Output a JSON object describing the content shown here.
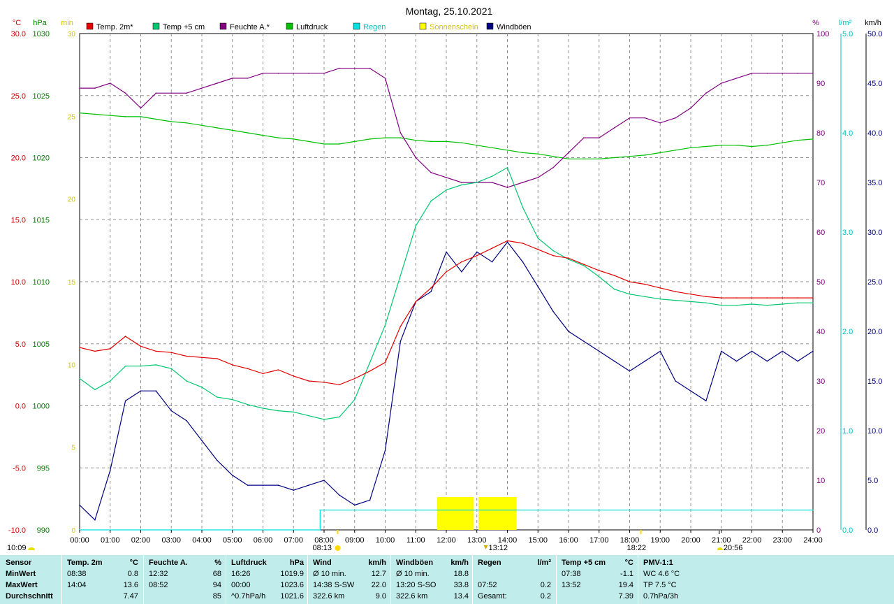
{
  "title": "Montag, 25.10.2021",
  "axes": {
    "temp": {
      "unit": "°C",
      "ticks": [
        "30.0",
        "25.0",
        "20.0",
        "15.0",
        "10.0",
        "5.0",
        "0.0",
        "-5.0",
        "-10.0"
      ],
      "color": "#cc0000"
    },
    "pressure": {
      "unit": "hPa",
      "ticks": [
        "1030",
        "1025",
        "1020",
        "1015",
        "1010",
        "1005",
        "1000",
        "995",
        "990"
      ],
      "color": "#008000"
    },
    "minutes": {
      "unit": "min",
      "ticks": [
        "30",
        "25",
        "20",
        "15",
        "10",
        "5",
        "0"
      ],
      "color": "#d4c400"
    },
    "humidity": {
      "unit": "%",
      "ticks": [
        "100",
        "90",
        "80",
        "70",
        "60",
        "50",
        "40",
        "30",
        "20",
        "10",
        "0"
      ],
      "color": "#800080"
    },
    "rain": {
      "unit": "l/m²",
      "ticks": [
        "5.0",
        "4.0",
        "3.0",
        "2.0",
        "1.0",
        "0.0"
      ],
      "color": "#00c0c0"
    },
    "wind": {
      "unit": "km/h",
      "ticks": [
        "50.0",
        "45.0",
        "40.0",
        "35.0",
        "30.0",
        "25.0",
        "20.0",
        "15.0",
        "10.0",
        "5.0",
        "0.0"
      ],
      "color": "#000080"
    }
  },
  "legend": [
    {
      "label": "Temp. 2m*",
      "color": "#e00000"
    },
    {
      "label": "Temp +5 cm",
      "color": "#00c870"
    },
    {
      "label": "Feuchte A.*",
      "color": "#800080"
    },
    {
      "label": "Luftdruck",
      "color": "#00c000"
    },
    {
      "label": "Regen",
      "color": "#00e0e0"
    },
    {
      "label": "Sonnenschein",
      "color": "#ffff00"
    },
    {
      "label": "Windböen",
      "color": "#000080"
    }
  ],
  "time_ticks": [
    "00:00",
    "01:00",
    "02:00",
    "03:00",
    "04:00",
    "05:00",
    "06:00",
    "07:00",
    "08:00",
    "09:00",
    "10:00",
    "11:00",
    "12:00",
    "13:00",
    "14:00",
    "15:00",
    "16:00",
    "17:00",
    "18:00",
    "19:00",
    "20:00",
    "21:00",
    "22:00",
    "23:00",
    "24:00"
  ],
  "markers": {
    "moonset": "10:09",
    "sunrise": "08:13",
    "noon": "13:12",
    "sunset": "18:22",
    "moonrise": "20:56"
  },
  "chart_data": {
    "type": "line",
    "x_unit": "hour of day",
    "xlim": [
      0,
      24
    ],
    "series": [
      {
        "name": "Temp. 2m*",
        "axis": "temp",
        "x": [
          0,
          0.5,
          1,
          1.5,
          2,
          2.5,
          3,
          3.5,
          4,
          4.5,
          5,
          5.5,
          6,
          6.5,
          7,
          7.5,
          8,
          8.5,
          9,
          9.5,
          10,
          10.5,
          11,
          11.5,
          12,
          12.5,
          13,
          13.5,
          14,
          14.5,
          15,
          15.5,
          16,
          16.5,
          17,
          17.5,
          18,
          18.5,
          19,
          19.5,
          20,
          20.5,
          21,
          21.5,
          22,
          22.5,
          23,
          23.5,
          24
        ],
        "y": [
          4.7,
          4.4,
          4.6,
          5.6,
          4.8,
          4.4,
          4.3,
          4.0,
          3.9,
          3.8,
          3.3,
          3.0,
          2.6,
          2.9,
          2.4,
          2.0,
          1.9,
          1.7,
          2.2,
          2.8,
          3.5,
          6.4,
          8.4,
          9.5,
          10.8,
          11.6,
          12.1,
          12.7,
          13.3,
          13.1,
          12.6,
          12.1,
          11.9,
          11.4,
          10.9,
          10.5,
          10.0,
          9.8,
          9.5,
          9.2,
          9.0,
          8.8,
          8.7,
          8.7,
          8.7,
          8.7,
          8.7,
          8.7,
          8.7
        ]
      },
      {
        "name": "Temp +5 cm",
        "axis": "temp",
        "x": [
          0,
          0.5,
          1,
          1.5,
          2,
          2.5,
          3,
          3.5,
          4,
          4.5,
          5,
          5.5,
          6,
          6.5,
          7,
          7.5,
          8,
          8.5,
          9,
          9.5,
          10,
          10.5,
          11,
          11.5,
          12,
          12.5,
          13,
          13.5,
          14,
          14.5,
          15,
          15.5,
          16,
          16.5,
          17,
          17.5,
          18,
          18.5,
          19,
          19.5,
          20,
          20.5,
          21,
          21.5,
          22,
          22.5,
          23,
          23.5,
          24
        ],
        "y": [
          2.2,
          1.3,
          2.0,
          3.2,
          3.2,
          3.3,
          3.0,
          2.0,
          1.5,
          0.7,
          0.5,
          0.1,
          -0.2,
          -0.4,
          -0.5,
          -0.8,
          -1.1,
          -0.9,
          0.5,
          3.5,
          6.5,
          10.5,
          14.5,
          16.5,
          17.4,
          17.8,
          18.0,
          18.5,
          19.2,
          16.0,
          13.5,
          12.5,
          11.8,
          11.3,
          10.4,
          9.4,
          9.0,
          8.8,
          8.6,
          8.5,
          8.4,
          8.3,
          8.1,
          8.1,
          8.2,
          8.1,
          8.2,
          8.3,
          8.3
        ]
      },
      {
        "name": "Feuchte A.*",
        "axis": "humidity",
        "x": [
          0,
          0.5,
          1,
          1.5,
          2,
          2.5,
          3,
          3.5,
          4,
          4.5,
          5,
          5.5,
          6,
          6.5,
          7,
          7.5,
          8,
          8.5,
          9,
          9.5,
          10,
          10.5,
          11,
          11.5,
          12,
          12.5,
          13,
          13.5,
          14,
          14.5,
          15,
          15.5,
          16,
          16.5,
          17,
          17.5,
          18,
          18.5,
          19,
          19.5,
          20,
          20.5,
          21,
          21.5,
          22,
          22.5,
          23,
          23.5,
          24
        ],
        "y": [
          89,
          89,
          90,
          88,
          85,
          88,
          88,
          88,
          89,
          90,
          91,
          91,
          92,
          92,
          92,
          92,
          92,
          93,
          93,
          93,
          91,
          80,
          75,
          72,
          71,
          70,
          70,
          70,
          69,
          70,
          71,
          73,
          76,
          79,
          79,
          81,
          83,
          83,
          82,
          83,
          85,
          88,
          90,
          91,
          92,
          92,
          92,
          92,
          92
        ]
      },
      {
        "name": "Luftdruck",
        "axis": "pressure",
        "x": [
          0,
          0.5,
          1,
          1.5,
          2,
          2.5,
          3,
          3.5,
          4,
          4.5,
          5,
          5.5,
          6,
          6.5,
          7,
          7.5,
          8,
          8.5,
          9,
          9.5,
          10,
          10.5,
          11,
          11.5,
          12,
          12.5,
          13,
          13.5,
          14,
          14.5,
          15,
          15.5,
          16,
          16.5,
          17,
          17.5,
          18,
          18.5,
          19,
          19.5,
          20,
          20.5,
          21,
          21.5,
          22,
          22.5,
          23,
          23.5,
          24
        ],
        "y": [
          1023.6,
          1023.5,
          1023.4,
          1023.3,
          1023.3,
          1023.1,
          1022.9,
          1022.8,
          1022.6,
          1022.4,
          1022.2,
          1022.0,
          1021.8,
          1021.6,
          1021.5,
          1021.3,
          1021.1,
          1021.1,
          1021.3,
          1021.5,
          1021.6,
          1021.6,
          1021.4,
          1021.3,
          1021.3,
          1021.2,
          1021.0,
          1020.8,
          1020.6,
          1020.4,
          1020.3,
          1020.1,
          1019.9,
          1019.9,
          1019.9,
          1020.0,
          1020.1,
          1020.2,
          1020.4,
          1020.6,
          1020.8,
          1020.9,
          1021.0,
          1021.0,
          1020.9,
          1021.0,
          1021.2,
          1021.4,
          1021.5
        ]
      },
      {
        "name": "Windböen",
        "axis": "wind",
        "x": [
          0,
          0.5,
          1,
          1.5,
          2,
          2.5,
          3,
          3.5,
          4,
          4.5,
          5,
          5.5,
          6,
          6.5,
          7,
          7.5,
          8,
          8.5,
          9,
          9.5,
          10,
          10.5,
          11,
          11.5,
          12,
          12.5,
          13,
          13.5,
          14,
          14.5,
          15,
          15.5,
          16,
          16.5,
          17,
          17.5,
          18,
          18.5,
          19,
          19.5,
          20,
          20.5,
          21,
          21.5,
          22,
          22.5,
          23,
          23.5,
          24
        ],
        "y": [
          2.5,
          1.0,
          6.0,
          13.0,
          14.0,
          14.0,
          12.0,
          11.0,
          9.0,
          7.0,
          5.5,
          4.5,
          4.5,
          4.5,
          4.0,
          4.5,
          5.0,
          3.5,
          2.5,
          3.0,
          8.0,
          19.0,
          23.0,
          24.0,
          28.0,
          26.0,
          28.0,
          27.0,
          29.0,
          27.0,
          24.5,
          22.0,
          20.0,
          19.0,
          18.0,
          17.0,
          16.0,
          17.0,
          18.0,
          15.0,
          14.0,
          13.0,
          18.0,
          17.0,
          18.0,
          17.0,
          18.0,
          17.0,
          18.0
        ]
      },
      {
        "name": "Regen",
        "axis": "rain",
        "x": [
          0,
          7.87,
          7.87,
          24
        ],
        "y": [
          0,
          0,
          0.2,
          0.2
        ]
      }
    ],
    "sunshine_periods": [
      [
        11.7,
        12.9
      ],
      [
        13.05,
        14.3
      ]
    ]
  },
  "stats": {
    "sensor_header": "Sensor",
    "row_labels": [
      "MinWert",
      "MaxWert",
      "Durchschnitt"
    ],
    "columns": [
      {
        "name": "Temp. 2m",
        "unit": "°C",
        "rows": [
          [
            "08:38",
            "0.8"
          ],
          [
            "14:04",
            "13.6"
          ],
          [
            "",
            "7.47"
          ]
        ]
      },
      {
        "name": "Feuchte A.",
        "unit": "%",
        "rows": [
          [
            "12:32",
            "68"
          ],
          [
            "08:52",
            "94"
          ],
          [
            "",
            "85"
          ]
        ]
      },
      {
        "name": "Luftdruck",
        "unit": "hPa",
        "rows": [
          [
            "16:26",
            "1019.9"
          ],
          [
            "00:00",
            "1023.6"
          ],
          [
            "^0.7hPa/h",
            "1021.6"
          ]
        ]
      },
      {
        "name": "Wind",
        "unit": "km/h",
        "rows": [
          [
            "Ø 10 min.",
            "12.7"
          ],
          [
            "14:38 S-SW",
            "22.0"
          ],
          [
            "322.6 km",
            "9.0"
          ]
        ]
      },
      {
        "name": "Windböen",
        "unit": "km/h",
        "rows": [
          [
            "Ø 10 min.",
            "18.8"
          ],
          [
            "13:20 S-SO",
            "33.8"
          ],
          [
            "322.6 km",
            "13.4"
          ]
        ]
      },
      {
        "name": "Regen",
        "unit": "l/m²",
        "rows": [
          [
            "",
            ""
          ],
          [
            "07:52",
            "0.2"
          ],
          [
            "Gesamt:",
            "0.2"
          ]
        ]
      },
      {
        "name": "Temp +5 cm",
        "unit": "°C",
        "rows": [
          [
            "07:38",
            "-1.1"
          ],
          [
            "13:52",
            "19.4"
          ],
          [
            "",
            "7.39"
          ]
        ]
      },
      {
        "name": "PMV-1:1",
        "unit": "",
        "rows": [
          [
            "WC 4.6 °C",
            ""
          ],
          [
            "TP 7.5 °C",
            ""
          ],
          [
            "0.7hPa/3h",
            ""
          ]
        ]
      }
    ]
  }
}
